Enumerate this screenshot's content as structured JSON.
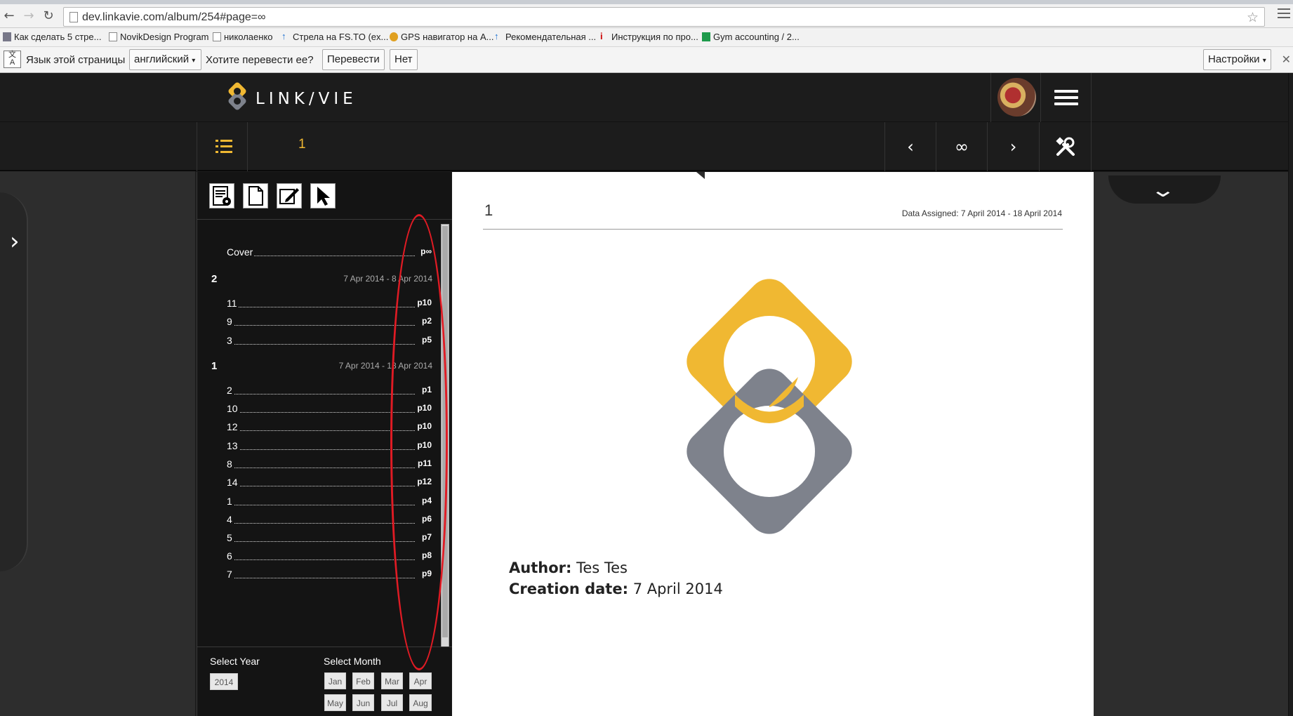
{
  "browser": {
    "url": "dev.linkavie.com/album/254#page=∞",
    "bookmarks": [
      "Как сделать 5 стре...",
      "NovikDesign Program",
      "николаенко",
      "Стрела на FS.TO (ex...",
      "GPS навигатор на А...",
      "Рекомендательная ...",
      "Инструкция по про...",
      "Gym accounting / 2..."
    ],
    "translate": {
      "page_lang_label": "Язык этой страницы",
      "lang_value": "английский",
      "question": "Хотите перевести ее?",
      "translate_btn": "Перевести",
      "no_btn": "Нет",
      "settings_btn": "Настройки"
    }
  },
  "app": {
    "logo_text": "LINK/VIE",
    "current_page": "1",
    "nav": {
      "prev": "‹",
      "infinity": "∞",
      "next": "›"
    }
  },
  "toc": {
    "cover": {
      "label": "Cover",
      "page": "p∞"
    },
    "groups": [
      {
        "num": "2",
        "dates": "7 Apr 2014 - 8 Apr 2014",
        "items": [
          {
            "label": "11",
            "page": "p10"
          },
          {
            "label": "9",
            "page": "p2"
          },
          {
            "label": "3",
            "page": "p5"
          }
        ]
      },
      {
        "num": "1",
        "dates": "7 Apr 2014 - 18 Apr 2014",
        "items": [
          {
            "label": "2",
            "page": "p1"
          },
          {
            "label": "10",
            "page": "p10"
          },
          {
            "label": "12",
            "page": "p10"
          },
          {
            "label": "13",
            "page": "p10"
          },
          {
            "label": "8",
            "page": "p11"
          },
          {
            "label": "14",
            "page": "p12"
          },
          {
            "label": "1",
            "page": "p4"
          },
          {
            "label": "4",
            "page": "p6"
          },
          {
            "label": "5",
            "page": "p7"
          },
          {
            "label": "6",
            "page": "p8"
          },
          {
            "label": "7",
            "page": "p9"
          }
        ]
      }
    ]
  },
  "selectors": {
    "year_title": "Select Year",
    "month_title": "Select Month",
    "years": [
      "2014"
    ],
    "months": [
      "Jan",
      "Feb",
      "Mar",
      "Apr",
      "May",
      "Jun",
      "Jul",
      "Aug"
    ]
  },
  "page": {
    "title": "1",
    "assigned": "Data Assigned: 7 April 2014 - 18 April 2014",
    "author_label": "Author:",
    "author_value": "Tes Tes",
    "date_label": "Creation date:",
    "date_value": "7 April 2014"
  },
  "colors": {
    "accent": "#f0b832",
    "logo_gray": "#7e828c",
    "annotation": "#e01b24"
  }
}
